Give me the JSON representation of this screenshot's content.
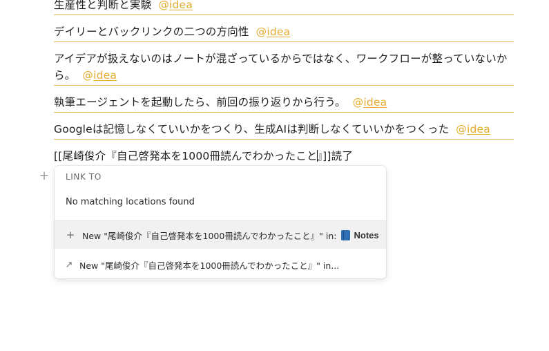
{
  "blocks": [
    {
      "text": "生産性と判断と実験",
      "mention": "idea"
    },
    {
      "text": "デイリーとバックリンクの二つの方向性",
      "mention": "idea"
    },
    {
      "text": "アイデアが扱えないのはノートが混ざっているからではなく、ワークフローが整っていないから。",
      "mention": "idea"
    },
    {
      "text": "執筆エージェントを起動したら、前回の振り返りから行う。",
      "mention": "idea"
    },
    {
      "text": "Googleは記憶しなくていいかをつくり、生成AIは判断しなくていいかをつくった",
      "mention": "idea"
    }
  ],
  "editing_line": {
    "before_caret": "[[尾崎俊介『自己啓発本を1000冊読んでわかったこと",
    "after_caret": "』]]読了"
  },
  "popup": {
    "header": "LINK TO",
    "no_match": "No matching locations found",
    "options": [
      {
        "label": "New \"尾崎俊介『自己啓発本を1000冊読んでわかったこと』\" in:",
        "notebook": "Notes",
        "icon": "plus-icon"
      },
      {
        "label": "New \"尾崎俊介『自己啓発本を1000冊読んでわかったこと』\" in...",
        "icon": "arrow-up-right-icon"
      }
    ]
  },
  "colors": {
    "mention": "#e4ab2c",
    "underline": "#e2b64c",
    "selected_option_bg": "#f1f1f1"
  }
}
